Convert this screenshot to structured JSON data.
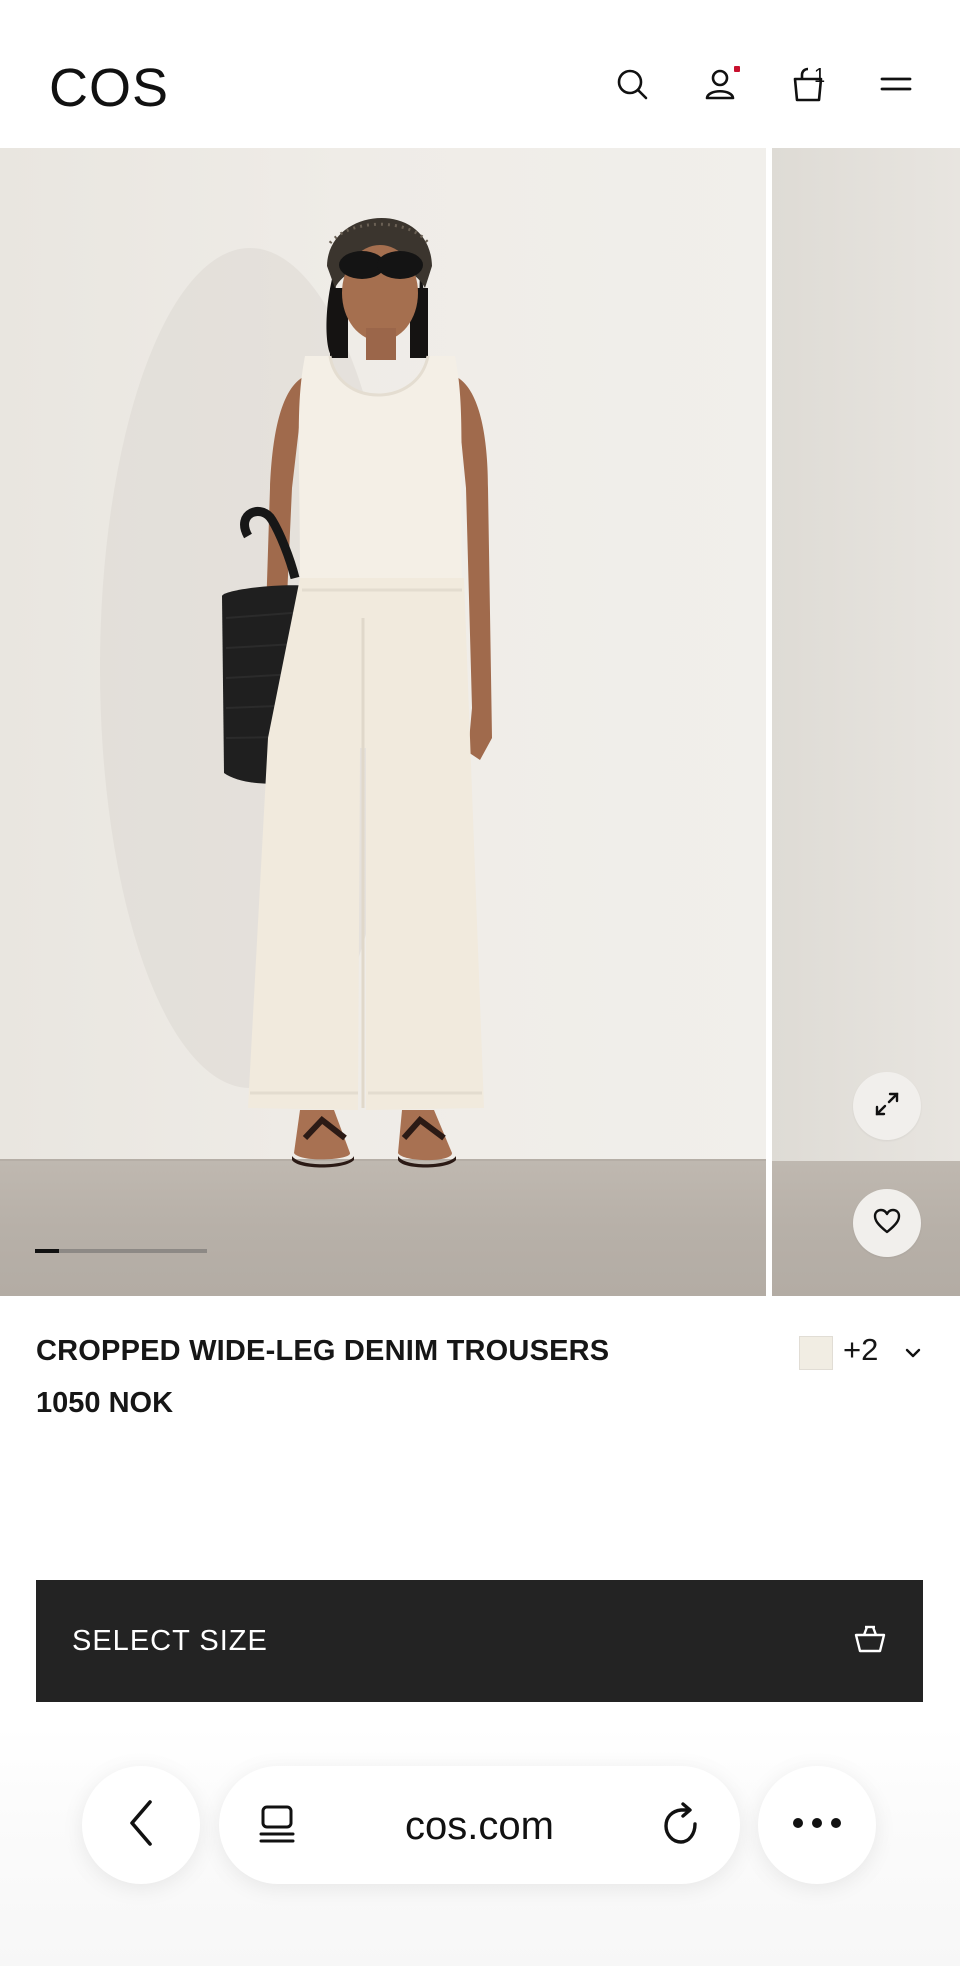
{
  "header": {
    "logo": "COS",
    "icons": [
      "search-icon",
      "account-icon",
      "bag-icon",
      "menu-icon"
    ],
    "bag_count": "1",
    "notification_dot_color": "#c8102e"
  },
  "gallery": {
    "progress_fraction": 0.14,
    "buttons": [
      "expand-icon",
      "heart-icon"
    ]
  },
  "product": {
    "title": "CROPPED WIDE-LEG DENIM TROUSERS",
    "price": "1050 NOK",
    "swatch_color": "#f1ede3",
    "more_colors": "+2"
  },
  "select_size": {
    "label": "SELECT SIZE",
    "background": "#232323"
  },
  "browser": {
    "url": "cos.com",
    "icons": [
      "back-icon",
      "tabs-icon",
      "reload-icon",
      "more-icon"
    ]
  }
}
